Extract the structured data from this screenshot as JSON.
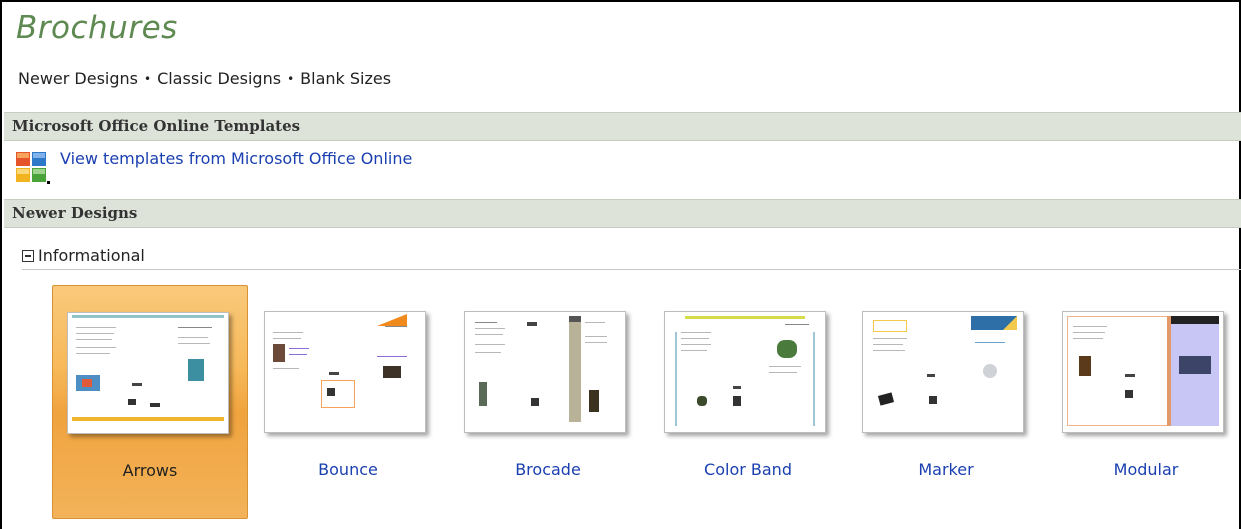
{
  "page": {
    "title": "Brochures",
    "nav": {
      "newer": "Newer Designs",
      "classic": "Classic Designs",
      "blank": "Blank Sizes",
      "bullet": "•"
    }
  },
  "sections": {
    "online": {
      "header": "Microsoft Office Online Templates",
      "link_text": "View templates from Microsoft Office Online",
      "icon": "office-online-icon"
    },
    "newer": {
      "header": "Newer Designs",
      "group_label": "Informational",
      "group_icon": "collapse-icon"
    }
  },
  "templates": [
    {
      "label": "Arrows",
      "selected": true
    },
    {
      "label": "Bounce",
      "selected": false
    },
    {
      "label": "Brocade",
      "selected": false
    },
    {
      "label": "Color Band",
      "selected": false
    },
    {
      "label": "Marker",
      "selected": false
    },
    {
      "label": "Modular",
      "selected": false
    }
  ],
  "colors": {
    "title": "#5e8a52",
    "link": "#1a3fb0",
    "section_bar": "#dde3d9",
    "selected_tile": "#f7b95a"
  }
}
